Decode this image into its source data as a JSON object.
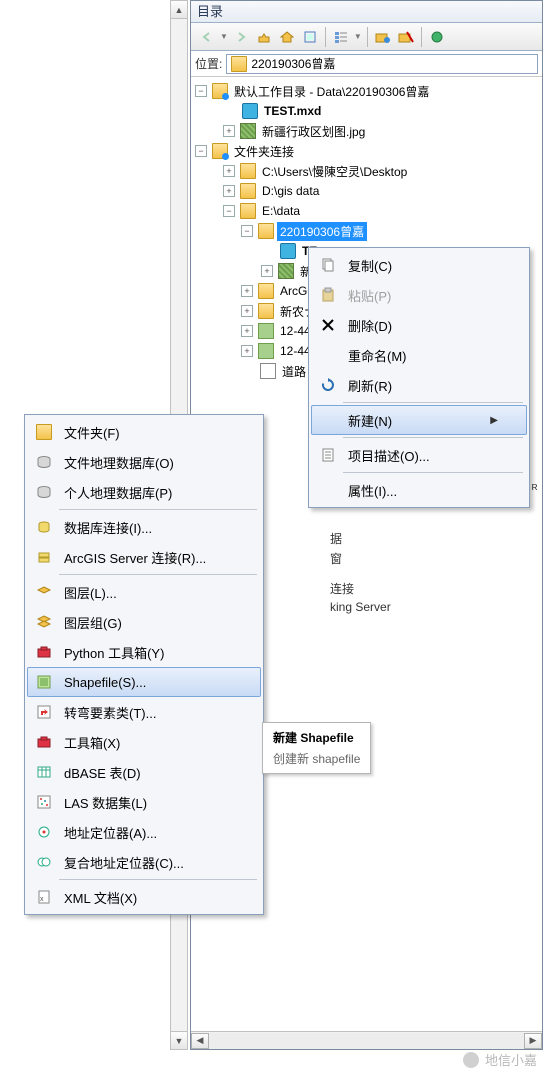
{
  "catalog": {
    "title": "目录",
    "location_label": "位置:",
    "location_value": "220190306曾嘉",
    "toolbar": {
      "back": "back",
      "fwd": "forward",
      "up": "up-level",
      "home": "home",
      "toggle": "toggle",
      "view": "view-menu",
      "connect": "folder-connection",
      "gis": "gis-server",
      "refresh": "refresh"
    },
    "tree": {
      "root_label": "默认工作目录 - Data\\220190306曾嘉",
      "items": [
        {
          "icon": "mxd",
          "label": "TEST.mxd",
          "bold": true
        },
        {
          "icon": "raster",
          "label": "新疆行政区划图.jpg",
          "expander": "+"
        }
      ],
      "folder_conn_label": "文件夹连接",
      "conns": [
        {
          "label": "C:\\Users\\慢陳空灵\\Desktop",
          "expander": "+"
        },
        {
          "label": "D:\\gis data",
          "expander": "+"
        },
        {
          "label": "E:\\data",
          "expander": "-"
        }
      ],
      "edata_child_label": "220190306曾嘉",
      "edata_child_expander": "-",
      "edata_grandchildren": [
        {
          "icon": "mxd",
          "label": "TE"
        },
        {
          "icon": "raster",
          "label": "新",
          "expander": "+"
        },
        {
          "icon": "folder",
          "label": "ArcGI",
          "expander": "+"
        },
        {
          "icon": "folder",
          "label": "新农ナ",
          "expander": "+"
        },
        {
          "icon": "grid",
          "label": "12-44",
          "expander": "+"
        },
        {
          "icon": "grid",
          "label": "12-44",
          "expander": "+"
        },
        {
          "icon": "doc",
          "label": "道路"
        }
      ]
    }
  },
  "peek_labels": {
    "p1": "ᴿ",
    "p2": "据",
    "p3": "窗",
    "p4": "连接",
    "p5": "king Server"
  },
  "context_menu": {
    "copy": "复制(C)",
    "paste": "粘贴(P)",
    "delete": "删除(D)",
    "rename": "重命名(M)",
    "refresh": "刷新(R)",
    "new": "新建(N)",
    "describe": "项目描述(O)...",
    "props": "属性(I)..."
  },
  "new_menu": {
    "folder": "文件夹(F)",
    "fgdb": "文件地理数据库(O)",
    "pgdb": "个人地理数据库(P)",
    "dbconn": "数据库连接(I)...",
    "agsconn": "ArcGIS Server 连接(R)...",
    "layer": "图层(L)...",
    "layergroup": "图层组(G)",
    "pytoolbox": "Python 工具箱(Y)",
    "shapefile": "Shapefile(S)...",
    "turn": "转弯要素类(T)...",
    "toolbox": "工具箱(X)",
    "dbase": "dBASE 表(D)",
    "las": "LAS 数据集(L)",
    "locator": "地址定位器(A)...",
    "comp_locator": "复合地址定位器(C)...",
    "xml": "XML 文档(X)"
  },
  "tooltip": {
    "title": "新建 Shapefile",
    "desc": "创建新 shapefile"
  },
  "watermark": "地信小嘉"
}
